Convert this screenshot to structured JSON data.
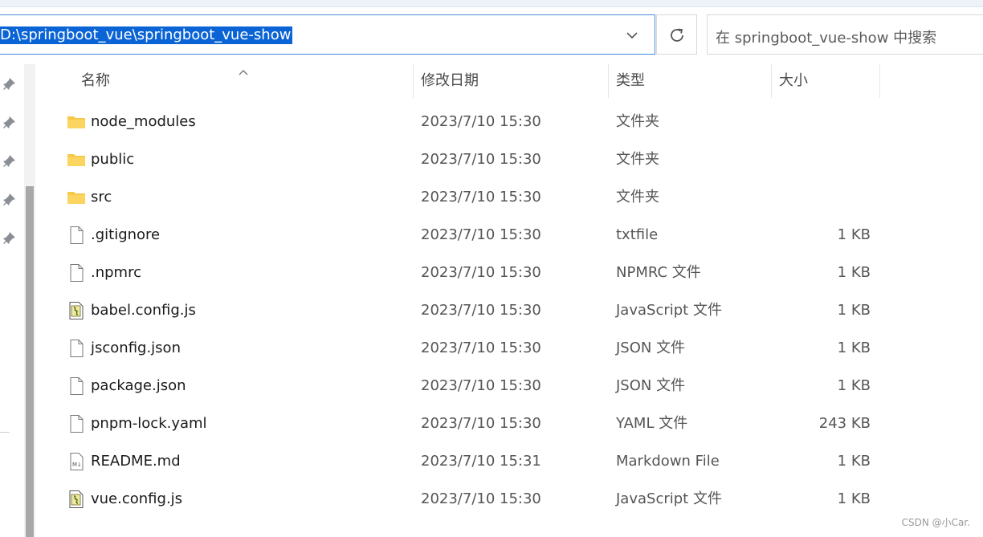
{
  "address": {
    "path": "D:\\springboot_vue\\springboot_vue-show"
  },
  "search": {
    "placeholder": "在 springboot_vue-show 中搜索"
  },
  "columns": {
    "name": "名称",
    "date": "修改日期",
    "type": "类型",
    "size": "大小"
  },
  "files": [
    {
      "icon": "folder-icon",
      "name": "node_modules",
      "date": "2023/7/10 15:30",
      "type": "文件夹",
      "size": ""
    },
    {
      "icon": "folder-icon",
      "name": "public",
      "date": "2023/7/10 15:30",
      "type": "文件夹",
      "size": ""
    },
    {
      "icon": "folder-icon",
      "name": "src",
      "date": "2023/7/10 15:30",
      "type": "文件夹",
      "size": ""
    },
    {
      "icon": "file-icon",
      "name": ".gitignore",
      "date": "2023/7/10 15:30",
      "type": "txtfile",
      "size": "1 KB"
    },
    {
      "icon": "file-icon",
      "name": ".npmrc",
      "date": "2023/7/10 15:30",
      "type": "NPMRC 文件",
      "size": "1 KB"
    },
    {
      "icon": "js-file-icon",
      "name": "babel.config.js",
      "date": "2023/7/10 15:30",
      "type": "JavaScript 文件",
      "size": "1 KB"
    },
    {
      "icon": "file-icon",
      "name": "jsconfig.json",
      "date": "2023/7/10 15:30",
      "type": "JSON 文件",
      "size": "1 KB"
    },
    {
      "icon": "file-icon",
      "name": "package.json",
      "date": "2023/7/10 15:30",
      "type": "JSON 文件",
      "size": "1 KB"
    },
    {
      "icon": "file-icon",
      "name": "pnpm-lock.yaml",
      "date": "2023/7/10 15:30",
      "type": "YAML 文件",
      "size": "243 KB"
    },
    {
      "icon": "markdown-file-icon",
      "name": "README.md",
      "date": "2023/7/10 15:31",
      "type": "Markdown File",
      "size": "1 KB"
    },
    {
      "icon": "js-file-icon",
      "name": "vue.config.js",
      "date": "2023/7/10 15:30",
      "type": "JavaScript 文件",
      "size": "1 KB"
    }
  ],
  "watermark": "CSDN @小Car."
}
